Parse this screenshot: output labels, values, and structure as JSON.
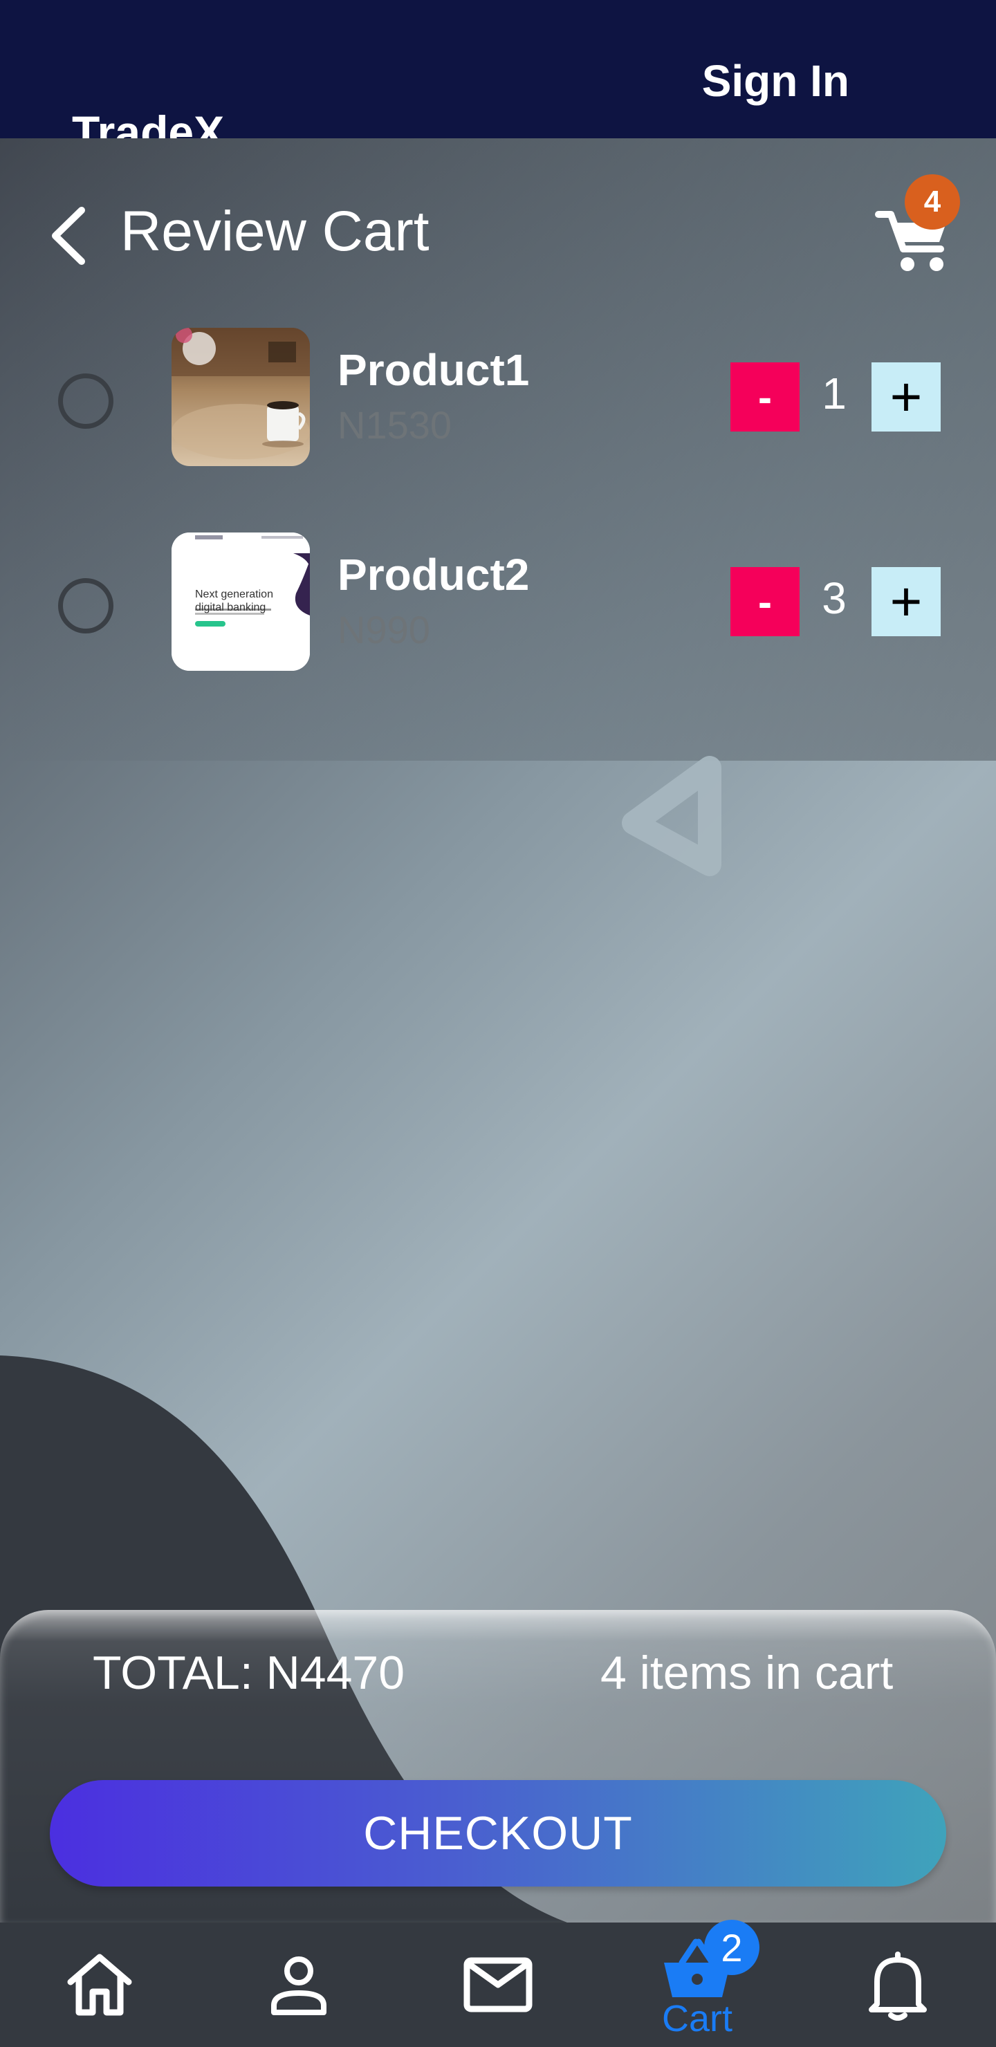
{
  "header": {
    "brand": "TradeX",
    "sign_in": "Sign In"
  },
  "cart_header": {
    "title": "Review Cart",
    "cart_badge": "4"
  },
  "items": [
    {
      "name": "Product1",
      "price": "N1530",
      "quantity": "1",
      "minus": "-",
      "plus": "+",
      "thumbnail": "coffee-cup-photo"
    },
    {
      "name": "Product2",
      "price": "N990",
      "quantity": "3",
      "minus": "-",
      "plus": "+",
      "thumbnail": "banking-website-screenshot",
      "thumb_text": "Next generation digital banking"
    }
  ],
  "summary": {
    "total": "TOTAL: N4470",
    "items_in_cart": "4 items in cart",
    "checkout": "CHECKOUT"
  },
  "bottom_nav": {
    "items": [
      "home-icon",
      "profile-icon",
      "mail-icon",
      "cart-basket-icon",
      "bell-icon"
    ],
    "active_label": "Cart",
    "cart_badge": "2"
  },
  "colors": {
    "header_bg": "#0e1442",
    "minus_btn": "#f5005a",
    "plus_btn": "#c8edf7",
    "cart_badge": "#d9601e",
    "nav_accent": "#1a7cf5",
    "nav_bg": "#343940"
  }
}
